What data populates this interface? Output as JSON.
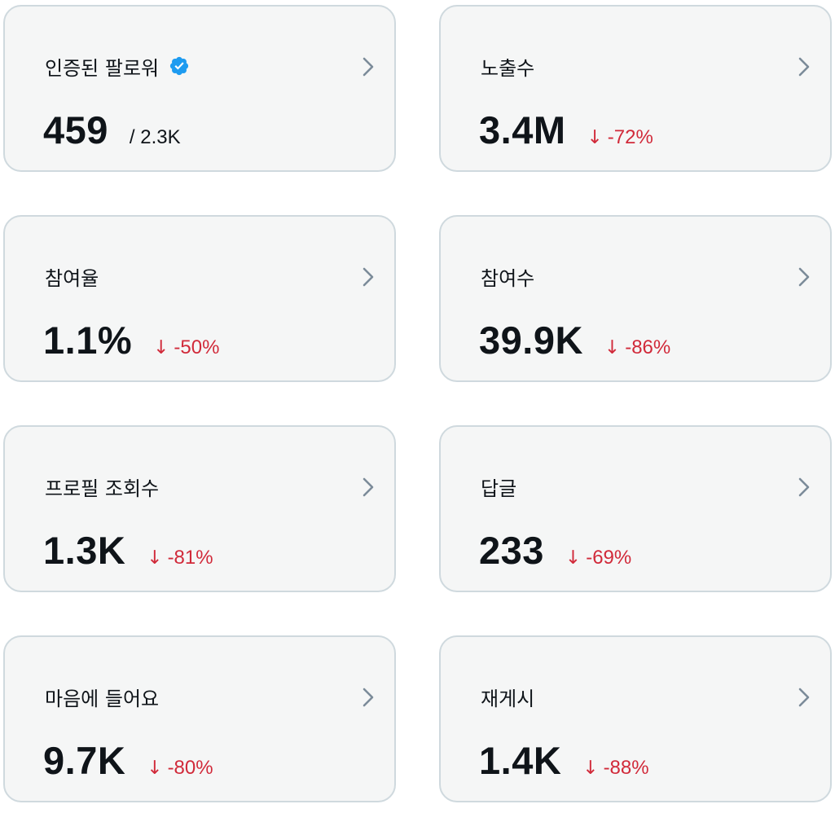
{
  "colors": {
    "card_background": "#f5f6f6",
    "card_border": "#cfd9de",
    "text": "#0f1419",
    "negative": "#d12a3a",
    "chevron": "#7b8b99",
    "verified_badge": "#1d9bf0"
  },
  "icons": {
    "verified": "verified-badge-icon",
    "chevron": "chevron-right-icon",
    "trend_down": "arrow-down-icon"
  },
  "cards": [
    {
      "label": "인증된 팔로워",
      "value": "459",
      "secondary": "/ 2.3K"
    },
    {
      "label": "노출수",
      "value": "3.4M",
      "arrow": "↓",
      "change": "-72%"
    },
    {
      "label": "참여율",
      "value": "1.1%",
      "arrow": "↓",
      "change": "-50%"
    },
    {
      "label": "참여수",
      "value": "39.9K",
      "arrow": "↓",
      "change": "-86%"
    },
    {
      "label": "프로필 조회수",
      "value": "1.3K",
      "arrow": "↓",
      "change": "-81%"
    },
    {
      "label": "답글",
      "value": "233",
      "arrow": "↓",
      "change": "-69%"
    },
    {
      "label": "마음에 들어요",
      "value": "9.7K",
      "arrow": "↓",
      "change": "-80%"
    },
    {
      "label": "재게시",
      "value": "1.4K",
      "arrow": "↓",
      "change": "-88%"
    }
  ]
}
